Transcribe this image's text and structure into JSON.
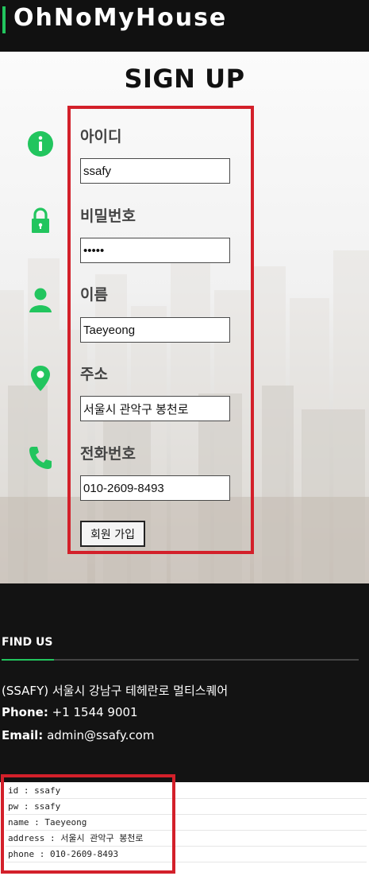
{
  "header": {
    "brand": "OhNoMyHouse"
  },
  "page": {
    "title": "SIGN UP"
  },
  "form": {
    "fields": [
      {
        "label": "아이디",
        "value": "ssafy",
        "type": "text",
        "icon": "info-icon"
      },
      {
        "label": "비밀번호",
        "value": "ssafy",
        "type": "password",
        "icon": "lock-icon"
      },
      {
        "label": "이름",
        "value": "Taeyeong",
        "type": "text",
        "icon": "user-icon"
      },
      {
        "label": "주소",
        "value": "서울시 관악구 봉천로",
        "type": "text",
        "icon": "map-pin-icon"
      },
      {
        "label": "전화번호",
        "value": "010-2609-8493",
        "type": "text",
        "icon": "phone-icon"
      }
    ],
    "submit_label": "회원 가입"
  },
  "footer": {
    "title": "FIND US",
    "address": "(SSAFY) 서울시 강남구 테헤란로 멀티스퀘어",
    "phone_label": "Phone:",
    "phone_value": "+1 1544 9001",
    "email_label": "Email:",
    "email_value": "admin@ssafy.com"
  },
  "output": {
    "lines": [
      "id : ssafy",
      "pw : ssafy",
      "name : Taeyeong",
      "address : 서울시 관악구 봉천로",
      "phone : 010-2609-8493"
    ]
  },
  "colors": {
    "accent": "#22c55e",
    "highlight": "#d3202a",
    "header_bg": "#111111",
    "footer_bg": "#131313"
  }
}
